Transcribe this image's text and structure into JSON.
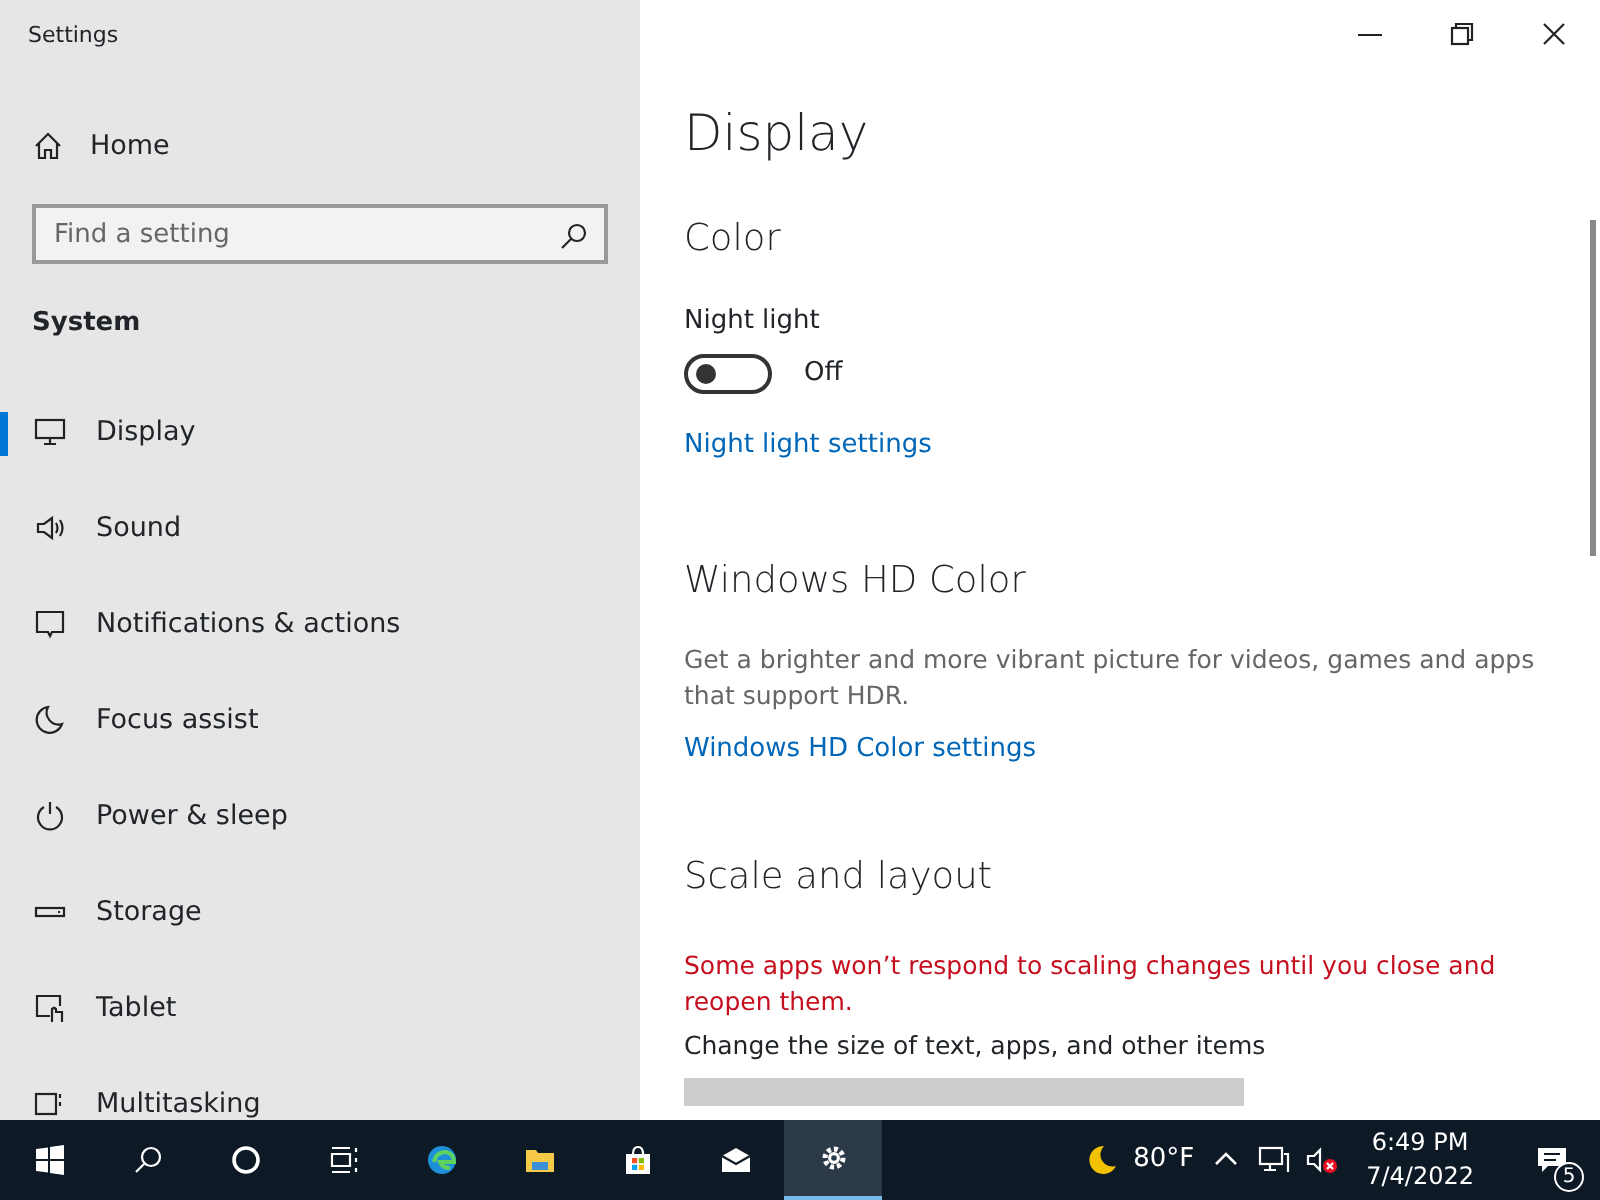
{
  "window": {
    "title": "Settings"
  },
  "sidebar": {
    "home": "Home",
    "search": {
      "placeholder": "Find a setting"
    },
    "section": "System",
    "items": [
      {
        "label": "Display",
        "selected": true
      },
      {
        "label": "Sound",
        "selected": false
      },
      {
        "label": "Notifications & actions",
        "selected": false
      },
      {
        "label": "Focus assist",
        "selected": false
      },
      {
        "label": "Power & sleep",
        "selected": false
      },
      {
        "label": "Storage",
        "selected": false
      },
      {
        "label": "Tablet",
        "selected": false
      },
      {
        "label": "Multitasking",
        "selected": false
      }
    ]
  },
  "content": {
    "title": "Display",
    "color": {
      "heading": "Color",
      "night_light": {
        "label": "Night light",
        "on": false,
        "state_text": "Off"
      },
      "link": "Night light settings"
    },
    "hd_color": {
      "heading": "Windows HD Color",
      "description": "Get a brighter and more vibrant picture for videos, games and apps that support HDR.",
      "link": "Windows HD Color settings"
    },
    "scale": {
      "heading": "Scale and layout",
      "warning": "Some apps won’t respond to scaling changes until you close and reopen them.",
      "label": "Change the size of text, apps, and other items"
    }
  },
  "taskbar": {
    "apps": [
      {
        "selected": false
      },
      {
        "selected": false
      },
      {
        "selected": false
      },
      {
        "selected": false
      },
      {
        "selected": false
      },
      {
        "selected": false
      },
      {
        "selected": false
      },
      {
        "selected": false
      },
      {
        "selected": true
      }
    ],
    "weather": "80°F",
    "time": "6:49 PM",
    "date": "7/4/2022",
    "notifications": "5"
  }
}
